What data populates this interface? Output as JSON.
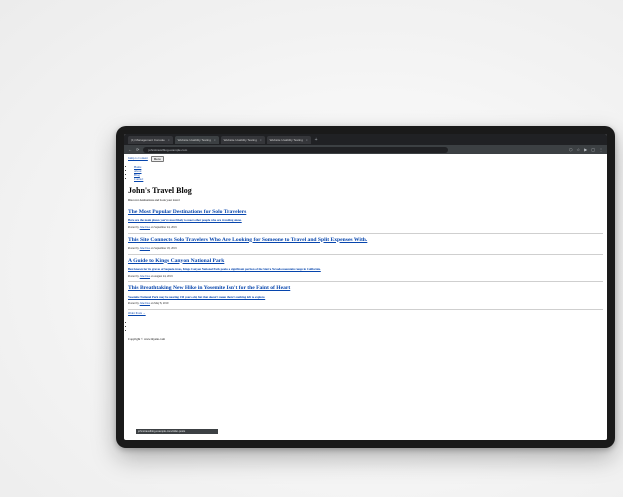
{
  "browser": {
    "tabs": [
      {
        "label": "(1) Management Console",
        "active": false
      },
      {
        "label": "Website Usability Testing",
        "active": true
      },
      {
        "label": "Website Usability Testing",
        "active": false
      },
      {
        "label": "Website Usability Testing",
        "active": false
      }
    ],
    "url": "johnstravelblog.example.com"
  },
  "page": {
    "skip_link": "Jump to Content",
    "menu_button": "Menu",
    "nav": [
      "Home",
      "About",
      "Blog",
      "Contact"
    ],
    "title": "John's Travel Blog",
    "tagline": "Discover destinations and book your travel",
    "posts": [
      {
        "title": "The Most Popular Destinations for Solo Travelers",
        "excerpt": "Here are the main places you’re most likely to meet other people who are traveling alone.",
        "meta_prefix": "Posted by",
        "author": "Jane Doe",
        "meta_suffix": "on September 24, 2019"
      },
      {
        "title": "This Site Connects Solo Travelers Who Are Looking for Someone to Travel and Split Expenses With.",
        "excerpt": "",
        "meta_prefix": "Posted by",
        "author": "Jane Doe",
        "meta_suffix": "on September 18, 2019"
      },
      {
        "title": "A Guide to Kings Canyon National Park",
        "excerpt": "Best known for its groves of Sequoia trees, Kings Canyon National Park peaks a significant portion of the Sierra Nevada mountain range in California.",
        "meta_prefix": "Posted by",
        "author": "Jane Doe",
        "meta_suffix": "on August 24, 2019"
      },
      {
        "title": "This Breathtaking New Hike in Yosemite Isn't for the Faint of Heart",
        "excerpt": "Yosemite National Park may be nearing 130 years old, but that doesn’t mean there’s nothing left to explore.",
        "meta_prefix": "Posted by",
        "author": "Jane Doe",
        "meta_suffix": "on May 8, 2019"
      }
    ],
    "older_posts": "Older Posts →",
    "copyright": "Copyright © www.mysite.com"
  },
  "status_bar": "johnstravelblog.example.com/older-posts"
}
